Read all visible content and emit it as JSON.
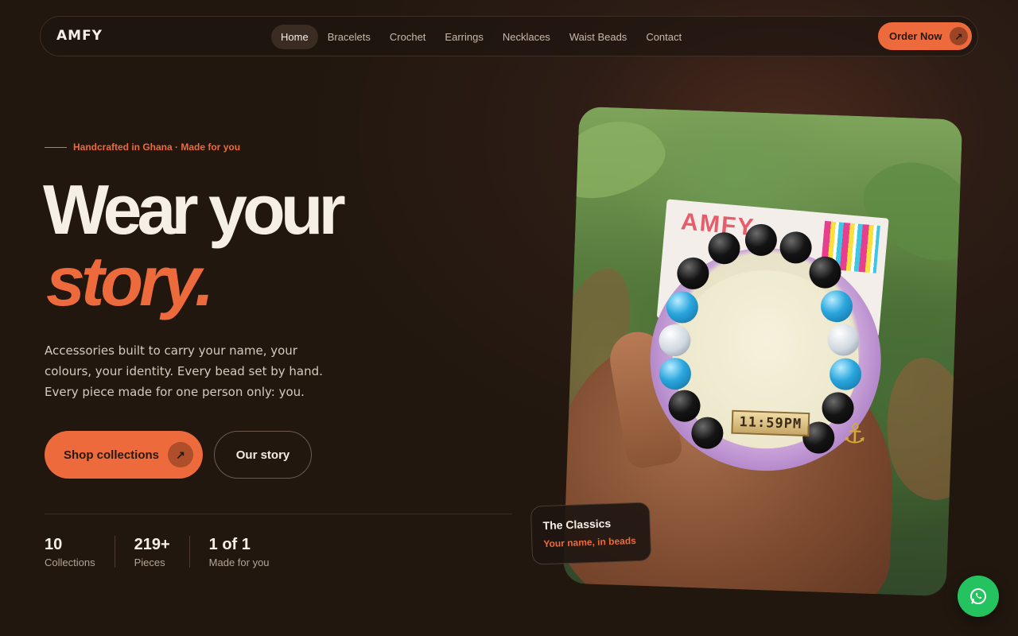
{
  "brand": {
    "name": "AMFY",
    "accent": "#ec6a3c"
  },
  "nav": {
    "links": [
      "Home",
      "Bracelets",
      "Crochet",
      "Earrings",
      "Necklaces",
      "Waist Beads",
      "Contact"
    ],
    "active": "Home",
    "cta_label": "Order Now"
  },
  "hero": {
    "eyebrow": "Handcrafted in Ghana · Made for you",
    "headline_line1": "Wear your",
    "headline_line2": "story.",
    "lede": "Accessories built to carry your name, your colours, your identity. Every bead set by hand. Every piece made for one person only: you.",
    "primary_button": "Shop collections",
    "secondary_button": "Our story"
  },
  "stats": [
    {
      "value": "10",
      "label": "Collections"
    },
    {
      "value": "219+",
      "label": "Pieces"
    },
    {
      "value": "1 of 1",
      "label": "Made for you"
    }
  ],
  "photo": {
    "card_text": "AMFY",
    "tag_text": "11:59PM"
  },
  "caption": {
    "title": "The Classics",
    "subtitle": "Your name, in beads"
  },
  "icons": {
    "whatsapp": "whatsapp-icon",
    "arrow": "arrow-up-right-icon"
  }
}
